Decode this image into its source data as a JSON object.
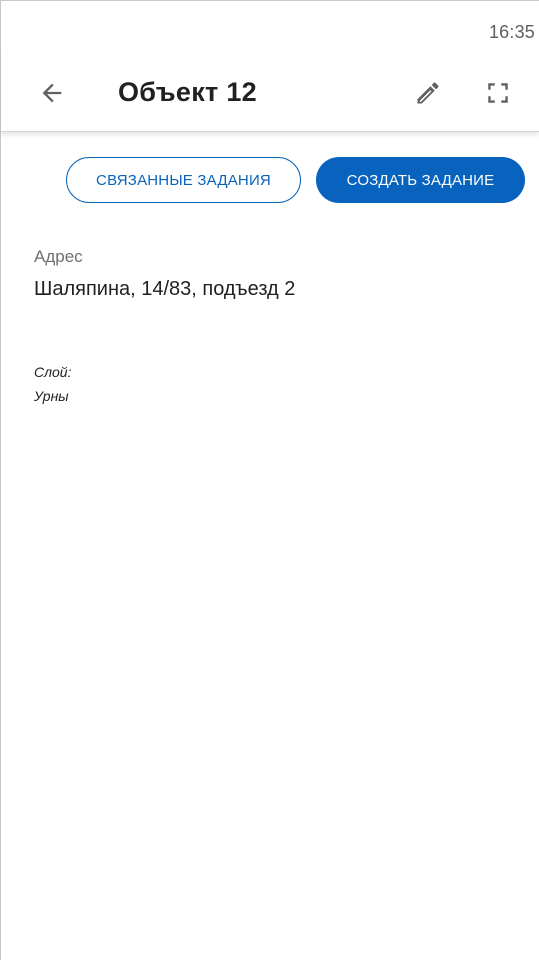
{
  "status_bar": {
    "time": "16:35"
  },
  "app_bar": {
    "title": "Объект 12",
    "icons": {
      "back": "arrow-back-icon",
      "edit": "pencil-icon",
      "fullscreen": "fullscreen-icon"
    }
  },
  "actions": {
    "related_tasks_label": "СВЯЗАННЫЕ ЗАДАНИЯ",
    "create_task_label": "СОЗДАТЬ ЗАДАНИЕ"
  },
  "address": {
    "label": "Адрес",
    "value": "Шаляпина, 14/83, подъезд 2"
  },
  "layer": {
    "label": "Слой:",
    "value": "Урны"
  },
  "colors": {
    "accent": "#0863be",
    "text_primary": "#212121",
    "text_secondary": "#6f6f6f"
  }
}
